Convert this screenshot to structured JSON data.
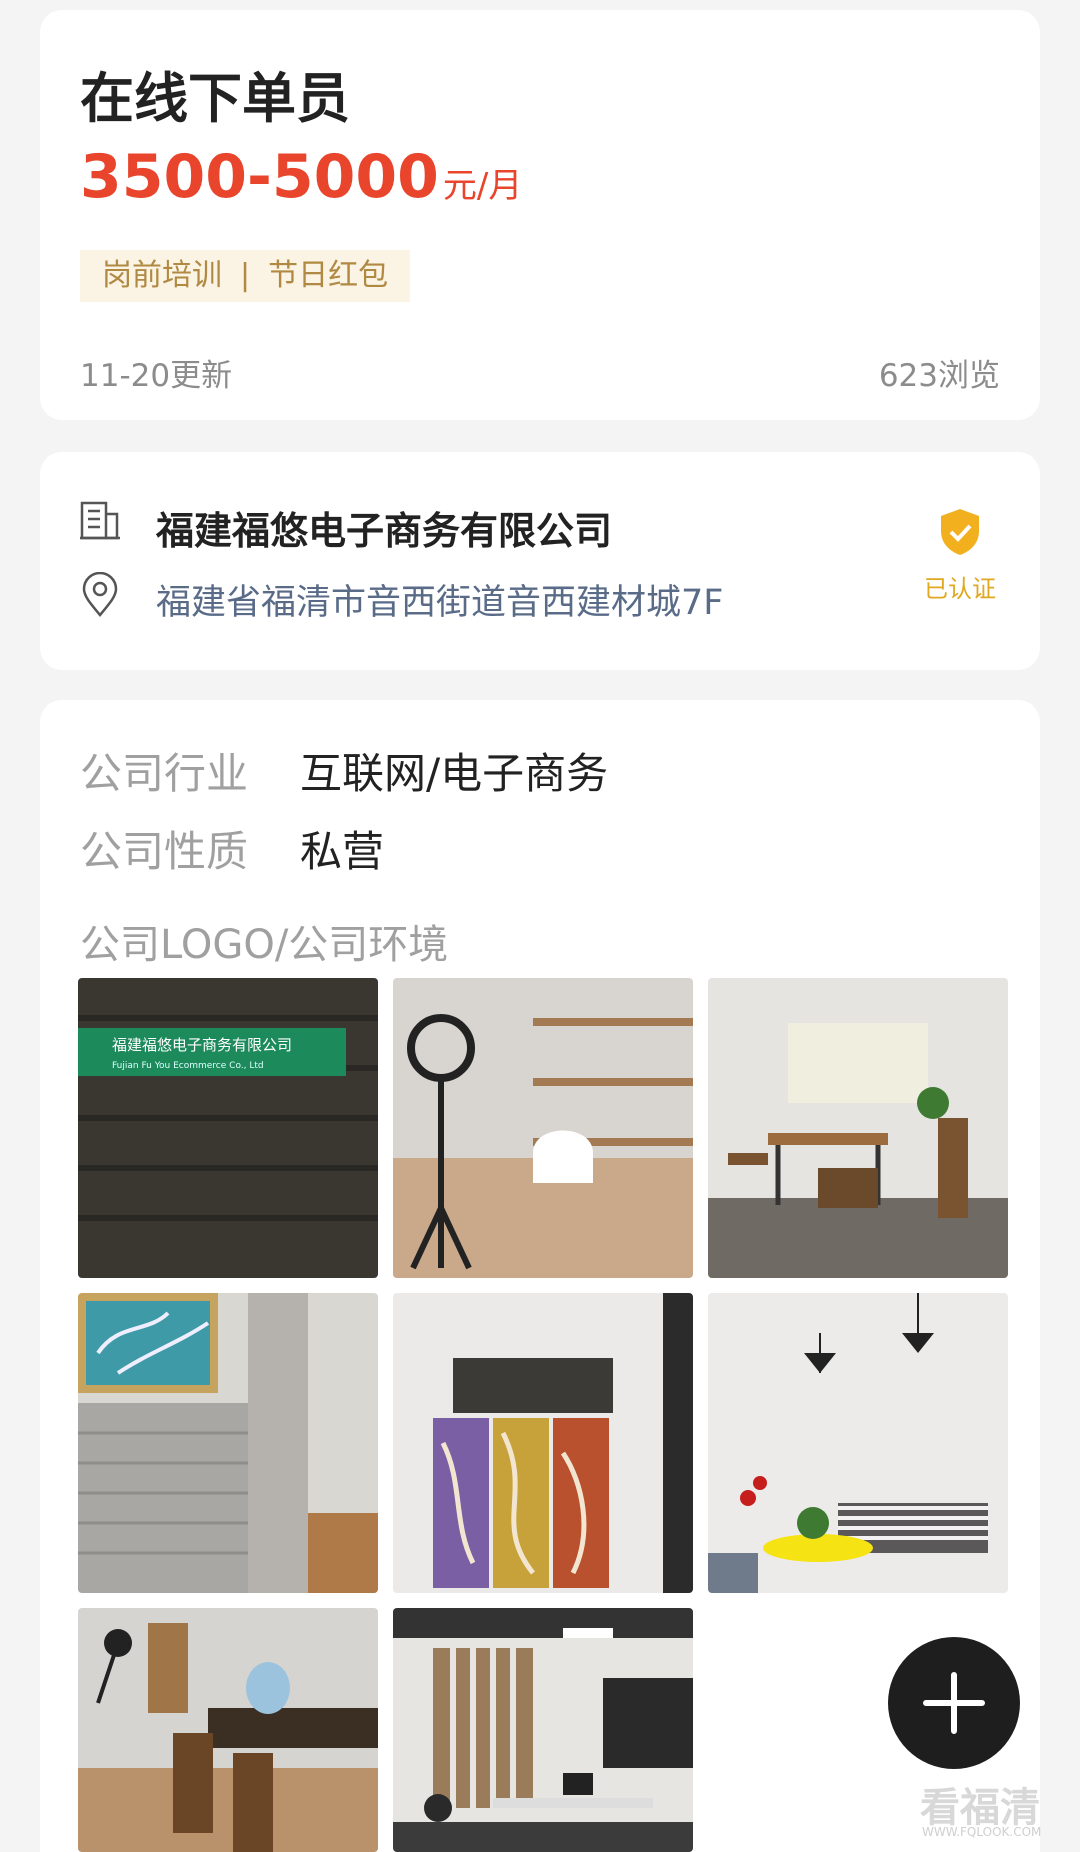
{
  "job": {
    "title": "在线下单员",
    "salary_amount": "3500-5000",
    "salary_unit": "元/月",
    "tags": [
      "岗前培训",
      "节日红包"
    ],
    "tag_separator": "|",
    "updated": "11-20更新",
    "views": "623浏览"
  },
  "company": {
    "name": "福建福悠电子商务有限公司",
    "address": "福建省福清市音西街道音西建材城7F",
    "verified_label": "已认证",
    "icons": {
      "building": "building-icon",
      "location": "location-pin-icon",
      "verified": "verified-shield-icon"
    }
  },
  "details": {
    "industry_label": "公司行业",
    "industry_value": "互联网/电子商务",
    "nature_label": "公司性质",
    "nature_value": "私营",
    "environment_label": "公司LOGO/公司环境",
    "sign_text": "福建福悠电子商务有限公司",
    "sign_subtext": "Fujian Fu You Ecommerce Co., Ltd"
  },
  "fab": {
    "icon": "plus-icon"
  },
  "watermark": {
    "text": "看福清",
    "sub": "WWW.FQLOOK.COM"
  },
  "colors": {
    "accent_red": "#e8452c",
    "tag_bg": "#fbf3e3",
    "tag_text": "#b08a43",
    "verify_gold": "#f2b01e",
    "address_blue": "#5a6b88"
  }
}
